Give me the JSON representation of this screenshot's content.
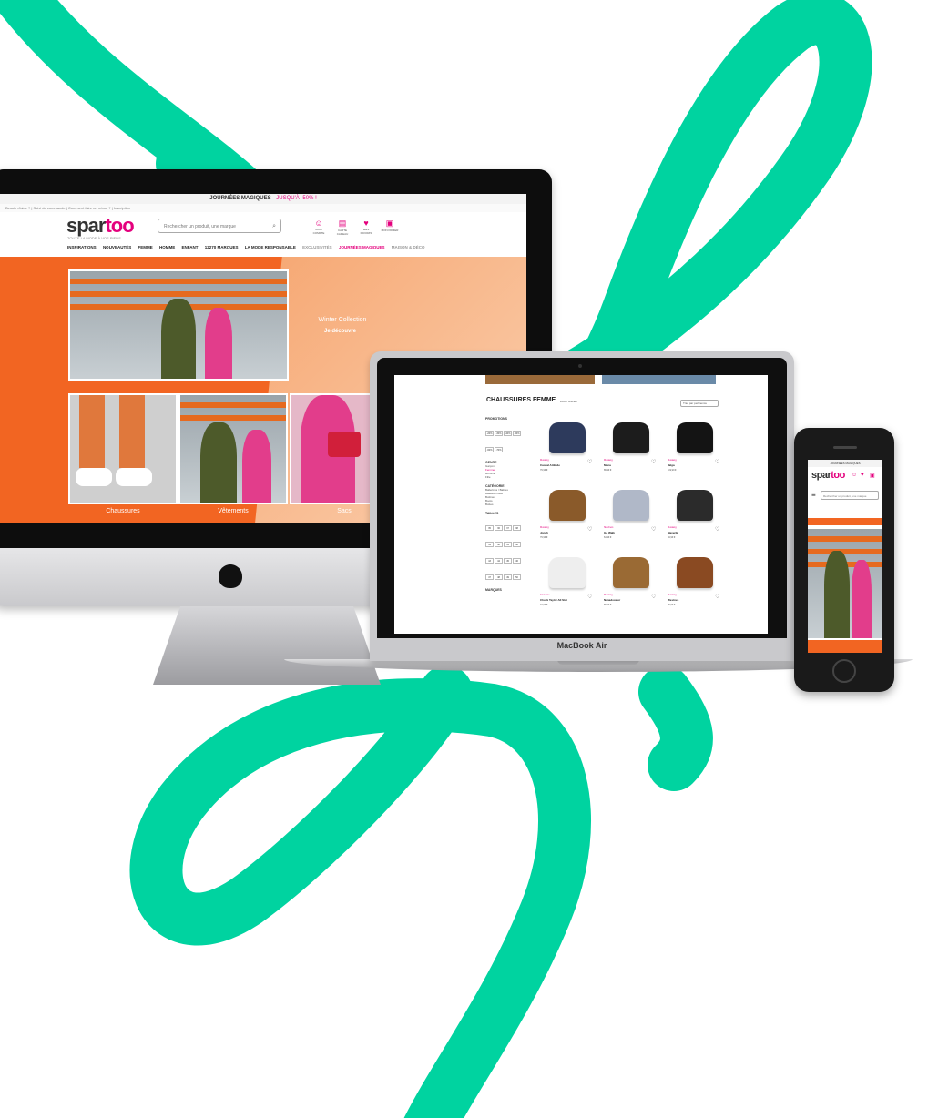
{
  "imac": {
    "top_banner": "JOURNÉES MAGIQUES",
    "top_banner_sub": "JUSQU'À -50% !",
    "sub_links": "Besoin d'aide ? | Suivi de commande | Comment faire un retour ? | Inscription",
    "logo_main": "spar",
    "logo_accent": "too",
    "tagline": "TOUTE LA MODE À VOS PIEDS",
    "search_placeholder": "Rechercher un produit, une marque",
    "header_icons": [
      {
        "icon": "user-icon",
        "label": "MON COMPTE"
      },
      {
        "icon": "card-icon",
        "label": "CARTE CADEAU"
      },
      {
        "icon": "heart-icon",
        "label": "MES FAVORIS"
      },
      {
        "icon": "bag-icon",
        "label": "MON PANIER"
      }
    ],
    "nav": [
      {
        "label": "INSPIRATIONS",
        "style": "normal"
      },
      {
        "label": "NOUVEAUTÉS",
        "style": "normal"
      },
      {
        "label": "FEMME",
        "style": "normal"
      },
      {
        "label": "HOMME",
        "style": "normal"
      },
      {
        "label": "ENFANT",
        "style": "normal"
      },
      {
        "label": "12270 MARQUES",
        "style": "normal"
      },
      {
        "label": "LA MODE RESPONSABLE",
        "style": "normal"
      },
      {
        "label": "EXCLUSIVITÉS",
        "style": "muted"
      },
      {
        "label": "JOURNÉES MAGIQUES",
        "style": "pink"
      },
      {
        "label": "MAISON & DÉCO",
        "style": "muted"
      }
    ],
    "hero_title": "Winter Collection",
    "hero_cta": "Je découvre",
    "categories": [
      "Chaussures",
      "Vêtements",
      "Sacs"
    ]
  },
  "macbook": {
    "label": "MacBook Air",
    "list_title": "CHAUSSURES FEMME",
    "list_count": "20097 articles",
    "sort_label": "Trier par pertinence",
    "filters": [
      {
        "title": "PROMOTIONS",
        "items": []
      },
      {
        "title": "GENRE",
        "items": [
          "Garçon",
          "Femme",
          "Homme",
          "Fille"
        ]
      },
      {
        "title": "CATÉGORIE",
        "items": [
          "Ballerines / Babies",
          "Baskets mode",
          "Bottines",
          "Boots",
          "Bottes"
        ]
      },
      {
        "title": "TAILLES",
        "items": []
      },
      {
        "title": "MARQUES",
        "items": []
      }
    ],
    "promo_chips": [
      "-20%",
      "-30%",
      "-40%",
      "-50%",
      "-60%",
      "-70%"
    ],
    "sizes": [
      "35",
      "36",
      "37",
      "38",
      "39",
      "40",
      "41",
      "42",
      "43",
      "44",
      "45",
      "46",
      "47",
      "48",
      "49",
      "50"
    ],
    "products": [
      {
        "brand": "Mustang",
        "name": "Casual Attitude",
        "price": "79,99 €",
        "color": "#2d3a5c"
      },
      {
        "brand": "Mustang",
        "name": "Mona",
        "price": "89,99 €",
        "color": "#1c1c1c"
      },
      {
        "brand": "Mustang",
        "name": "Jalga",
        "price": "119,99 €",
        "color": "#141414"
      },
      {
        "brand": "Mustang",
        "name": "Jonah",
        "price": "79,99 €",
        "color": "#8a5a2a"
      },
      {
        "brand": "Skechers",
        "name": "Go Walk",
        "price": "64,99 €",
        "color": "#b0b8c8"
      },
      {
        "brand": "Mustang",
        "name": "Maverik",
        "price": "69,99 €",
        "color": "#2b2b2b"
      },
      {
        "brand": "Converse",
        "name": "Chuck Taylor All Star",
        "price": "74,99 €",
        "color": "#eeeeee"
      },
      {
        "brand": "Mustang",
        "name": "Nanadoxeter",
        "price": "89,99 €",
        "color": "#9a6a34"
      },
      {
        "brand": "Mustang",
        "name": "Westnes",
        "price": "99,99 €",
        "color": "#8a4a22"
      }
    ]
  },
  "iphone": {
    "top_banner": "JOURNÉES MAGIQUES",
    "logo_main": "spar",
    "logo_accent": "too",
    "search_placeholder": "Rechercher un produit, une marque"
  },
  "colors": {
    "ribbon": "#00d3a0",
    "brand_pink": "#e4007d",
    "hero_orange": "#f26522"
  }
}
